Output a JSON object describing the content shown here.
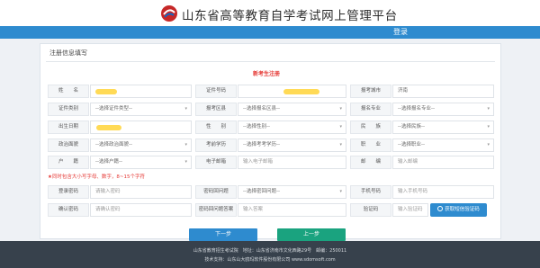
{
  "header": {
    "title": "山东省高等教育自学考试网上管理平台",
    "logo_icon": "exam-logo-icon"
  },
  "nav": {
    "login": "登录"
  },
  "panel": {
    "title": "注册信息填写",
    "heading": "新考生注册"
  },
  "form": {
    "name_label": "姓　　名",
    "id_no_label": "证件号码",
    "exam_city_label": "报考城市",
    "exam_city_value": "济南",
    "id_type_label": "证件类别",
    "id_type_value": "--选择证件类型--",
    "exam_area_label": "报考区县",
    "exam_area_value": "--选择报名区县--",
    "major_label": "报名专业",
    "major_value": "--选择报名专业--",
    "birth_label": "出生日期",
    "gender_label": "性　　别",
    "gender_value": "--选择性别--",
    "ethnic_label": "民　　族",
    "ethnic_value": "--选择民族--",
    "political_label": "政治面貌",
    "political_value": "--选择政治面貌--",
    "education_label": "考前学历",
    "education_value": "--选择考考学历--",
    "job_label": "职　　业",
    "job_value": "--选择职业--",
    "hukou_label": "户　　籍",
    "hukou_value": "--选择户籍--",
    "email_label": "电子邮箱",
    "email_placeholder": "输入电子邮箱",
    "post_label": "邮　　编",
    "post_placeholder": "输入邮编",
    "hint": "★同时包含大小写字母、数字，8~15个字符",
    "login_pwd_label": "登录密码",
    "login_pwd_placeholder": "请输入密码",
    "security_q_label": "密码回问题",
    "security_q_value": "--选择密回问题--",
    "mobile_label": "手机号码",
    "mobile_placeholder": "输入手机号码",
    "confirm_pwd_label": "确认密码",
    "confirm_pwd_placeholder": "请确认密码",
    "security_a_label": "密码回问题答案",
    "security_a_placeholder": "输入答案",
    "verify_code_label": "验证码",
    "verify_code_placeholder": "输入验证码",
    "get_code_button": "获取短信验证码"
  },
  "buttons": {
    "next": "下一步",
    "prev": "上一步"
  },
  "footer": {
    "line1": "山东省教育招生考试院　地址：山东省济南市文化西路29号　邮编：250011",
    "line2": "技术支持：山东山大鸥玛软件股份有限公司 www.sdomsoft.com"
  },
  "colors": {
    "primary": "#2e8bcf",
    "accent_green": "#1aa37f",
    "alert_red": "#e53935",
    "footer_bg": "#37414c"
  }
}
